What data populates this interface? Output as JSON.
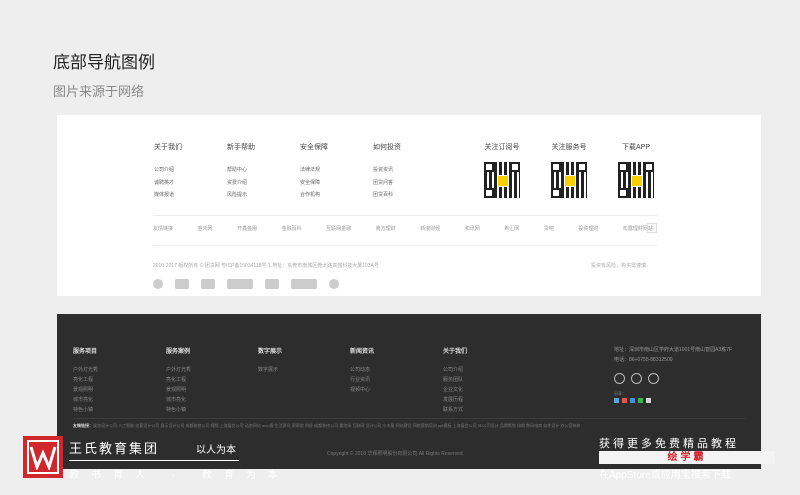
{
  "page": {
    "title": "底部导航图例",
    "subtitle": "图片来源于网络"
  },
  "white_footer": {
    "columns": [
      {
        "heading": "关于我们",
        "items": [
          "公司介绍",
          "诚聘英才",
          "媒体报道"
        ]
      },
      {
        "heading": "新手帮助",
        "items": [
          "帮助中心",
          "资费介绍",
          "风险提示"
        ]
      },
      {
        "heading": "安全保障",
        "items": [
          "法律法规",
          "安全保障",
          "合作机构"
        ]
      },
      {
        "heading": "如何投资",
        "items": [
          "投资资讯",
          "团贷问答",
          "团贷百科"
        ]
      }
    ],
    "qr_codes": [
      {
        "label": "关注订阅号",
        "icon": "qr-code-icon"
      },
      {
        "label": "关注服务号",
        "icon": "qr-code-icon"
      },
      {
        "label": "下载APP",
        "icon": "qr-code-icon"
      }
    ],
    "links": [
      "友情链接",
      "金元网",
      "开鑫金服",
      "金融百科",
      "互联网金融",
      "南方理财",
      "新浪财经",
      "和讯网",
      "希汇网",
      "贷吧",
      "投资理财",
      "松露理财网站"
    ],
    "more": "…",
    "copyright": "2010-2017 版权所有 © 团贷网 粤ICP备15034118号-1  地址：东莞市南城区莞太路高盛科技大厦103A号",
    "risk_note": "投资有风险，购买需谨慎"
  },
  "dark_footer": {
    "columns": [
      {
        "heading": "服务项目",
        "items": [
          "户外灯光秀",
          "亮化工程",
          "景观照明",
          "城市亮化",
          "特色小镇"
        ]
      },
      {
        "heading": "服务案例",
        "items": [
          "户外灯光秀",
          "亮化工程",
          "景观照明",
          "城市亮化",
          "特色小镇"
        ]
      },
      {
        "heading": "数字展示",
        "items": [
          "数字展示"
        ]
      },
      {
        "heading": "新闻资讯",
        "items": [
          "公司动态",
          "行业资讯",
          "视频中心"
        ]
      },
      {
        "heading": "关于我们",
        "items": [
          "公司介绍",
          "服务团队",
          "企业文化",
          "发展历程",
          "联系方式"
        ]
      }
    ],
    "contact": {
      "address": "地址：深圳市南山区学府大道1001号南山智园A3栋7F",
      "phone": "电话：86+0755-88312500"
    },
    "share_label": "分享：",
    "friend_links_label": "友情链接：",
    "friend_links": "展览设计公司 人工智能 创意设计公司 展示设计公司 成都装修公司 视频 上海展览公司 动态网站 moo客 生活资讯 帮帮助 财经 成都装修公司 重地场 互联网 设计公司 小木屋 网站建设 网络营销培训 ppt模板 上海展会公司 3D公司设计 品牌策划 排期 数码电商 软件设计 办公室装修",
    "copyright": "Copyright © 2018 华辉照明股份有限公司 All Rights Reserved"
  },
  "watermark": {
    "brand": "王氏教育集团",
    "tagline": "以人为本",
    "sub": "教书育人 · 教育为本",
    "ad_line1": "获得更多免费精品教程",
    "ad_line2": "绘学霸",
    "ad_line3": "在AppStore或应用宝搜索下载"
  },
  "colors": {
    "background": "#eeeeee",
    "dark_panel": "#2d2d2d",
    "brand_red": "#d0262c",
    "qr_center": "#f6d000"
  }
}
